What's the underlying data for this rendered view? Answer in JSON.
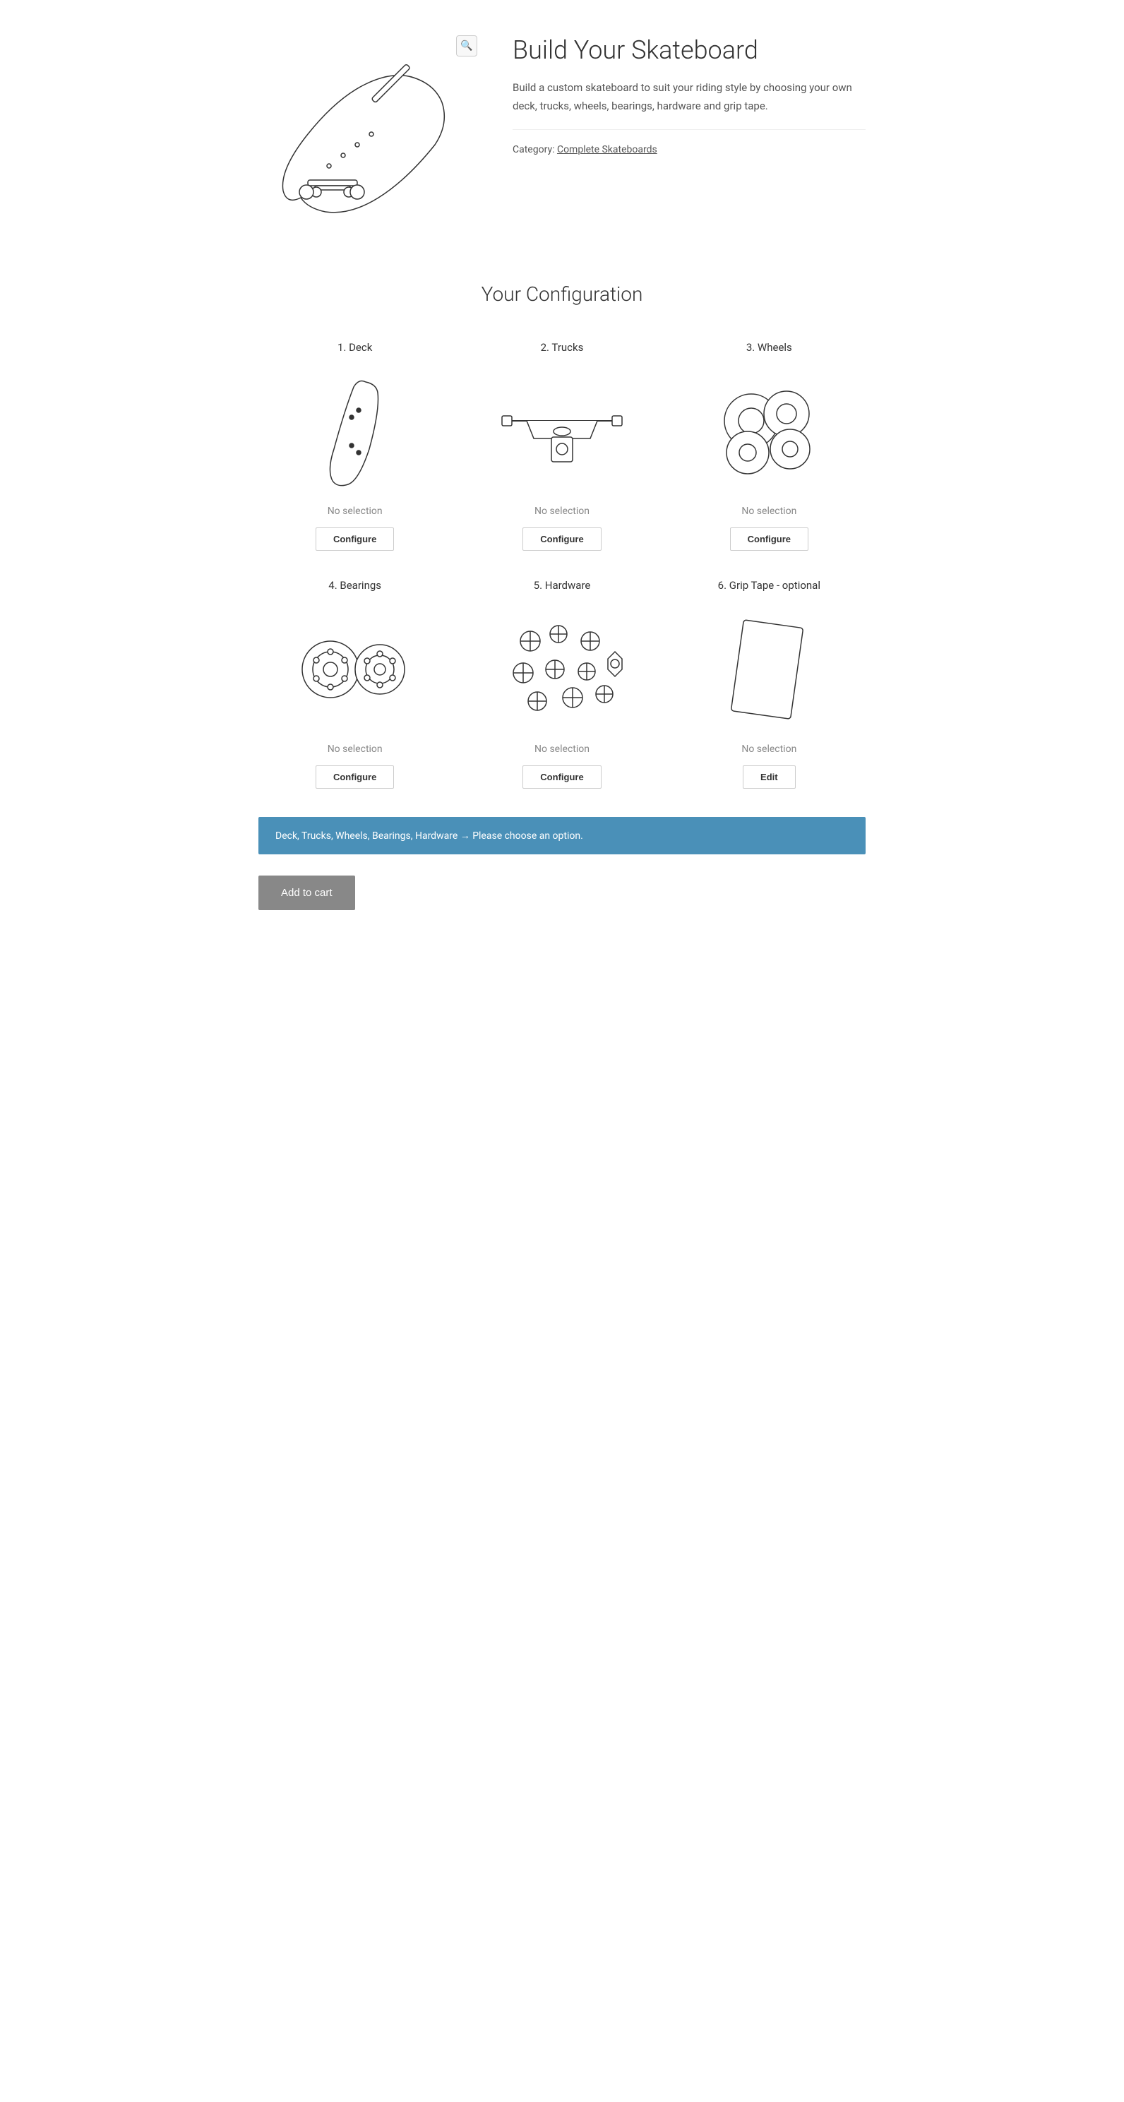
{
  "product": {
    "title": "Build Your Skateboard",
    "description": "Build a custom skateboard to suit your riding style by choosing your own deck, trucks, wheels, bearings, hardware and grip tape.",
    "category_label": "Category:",
    "category_link_text": "Complete Skateboards",
    "zoom_icon": "🔍"
  },
  "configuration": {
    "title": "Your Configuration",
    "items": [
      {
        "id": "deck",
        "number": 1,
        "label": "1. Deck",
        "no_selection": "No selection",
        "button": "Configure",
        "optional": false
      },
      {
        "id": "trucks",
        "number": 2,
        "label": "2. Trucks",
        "no_selection": "No selection",
        "button": "Configure",
        "optional": false
      },
      {
        "id": "wheels",
        "number": 3,
        "label": "3. Wheels",
        "no_selection": "No selection",
        "button": "Configure",
        "optional": false
      },
      {
        "id": "bearings",
        "number": 4,
        "label": "4. Bearings",
        "no_selection": "No selection",
        "button": "Configure",
        "optional": false
      },
      {
        "id": "hardware",
        "number": 5,
        "label": "5. Hardware",
        "no_selection": "No selection",
        "button": "Configure",
        "optional": false
      },
      {
        "id": "grip-tape",
        "number": 6,
        "label": "6. Grip Tape - optional",
        "no_selection": "No selection",
        "button": "Edit",
        "optional": true
      }
    ]
  },
  "alert": {
    "message": "Deck, Trucks, Wheels, Bearings, Hardware → Please choose an option."
  },
  "cart": {
    "button_label": "Add to cart"
  }
}
